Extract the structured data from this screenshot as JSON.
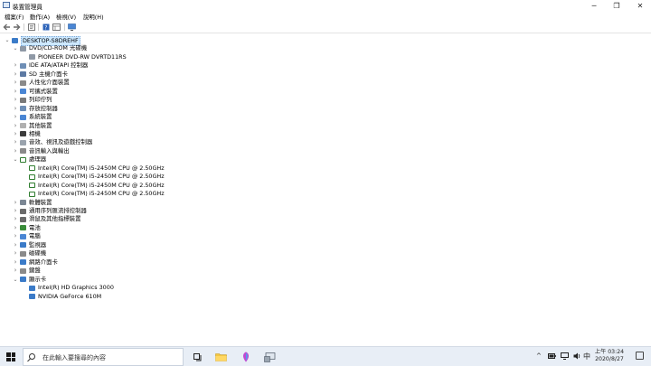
{
  "window": {
    "title": "裝置管理員",
    "minimize_glyph": "─",
    "maximize_glyph": "❐",
    "close_glyph": "✕"
  },
  "menu": [
    "檔案(F)",
    "動作(A)",
    "檢視(V)",
    "說明(H)"
  ],
  "toolbar": {
    "icons": [
      "back-arrow-icon",
      "forward-arrow-icon",
      "properties-icon",
      "help-icon",
      "view-icon",
      "monitor-scan-icon"
    ]
  },
  "tree": {
    "root": "DESKTOP-S8DREHF",
    "nodes": [
      {
        "label": "DVD/CD-ROM 光碟機",
        "expanded": true,
        "icon": "optical-drive-icon",
        "children": [
          "PIONEER DVD-RW DVRTD11RS"
        ]
      },
      {
        "label": "IDE ATA/ATAPI 控制器",
        "expanded": false,
        "icon": "ide-controller-icon"
      },
      {
        "label": "SD 主機介面卡",
        "expanded": false,
        "icon": "sd-host-icon"
      },
      {
        "label": "人性化介面裝置",
        "expanded": false,
        "icon": "hid-icon"
      },
      {
        "label": "可攜式裝置",
        "expanded": false,
        "icon": "portable-device-icon"
      },
      {
        "label": "列印佇列",
        "expanded": false,
        "icon": "printer-icon"
      },
      {
        "label": "存放控制器",
        "expanded": false,
        "icon": "storage-controller-icon"
      },
      {
        "label": "系統裝置",
        "expanded": false,
        "icon": "system-device-icon"
      },
      {
        "label": "其他裝置",
        "expanded": false,
        "icon": "other-device-icon"
      },
      {
        "label": "相機",
        "expanded": false,
        "icon": "camera-icon"
      },
      {
        "label": "音效、視訊及遊戲控制器",
        "expanded": false,
        "icon": "sound-icon"
      },
      {
        "label": "音訊輸入與輸出",
        "expanded": false,
        "icon": "audio-io-icon"
      },
      {
        "label": "處理器",
        "expanded": true,
        "icon": "processor-icon",
        "children": [
          "Intel(R) Core(TM) i5-2450M CPU @ 2.50GHz",
          "Intel(R) Core(TM) i5-2450M CPU @ 2.50GHz",
          "Intel(R) Core(TM) i5-2450M CPU @ 2.50GHz",
          "Intel(R) Core(TM) i5-2450M CPU @ 2.50GHz"
        ]
      },
      {
        "label": "軟體裝置",
        "expanded": false,
        "icon": "software-device-icon"
      },
      {
        "label": "通用序列匯流排控制器",
        "expanded": false,
        "icon": "usb-icon"
      },
      {
        "label": "滑鼠及其他指標裝置",
        "expanded": false,
        "icon": "mouse-icon"
      },
      {
        "label": "電池",
        "expanded": false,
        "icon": "battery-icon"
      },
      {
        "label": "電腦",
        "expanded": false,
        "icon": "computer-icon"
      },
      {
        "label": "監視器",
        "expanded": false,
        "icon": "monitor-icon"
      },
      {
        "label": "磁碟機",
        "expanded": false,
        "icon": "disk-drive-icon"
      },
      {
        "label": "網路介面卡",
        "expanded": false,
        "icon": "network-adapter-icon"
      },
      {
        "label": "鍵盤",
        "expanded": false,
        "icon": "keyboard-icon"
      },
      {
        "label": "顯示卡",
        "expanded": true,
        "icon": "display-adapter-icon",
        "children": [
          "Intel(R) HD Graphics 3000",
          "NVIDIA GeForce 610M"
        ]
      }
    ]
  },
  "taskbar": {
    "search_placeholder": "在此輸入要搜尋的內容",
    "tray_chevron": "^",
    "ime": "中",
    "time": "上午 03:24",
    "date": "2020/8/27"
  },
  "colors": {
    "selection": "#cce8ff",
    "taskbar": "#e8eef6",
    "folder_yellow": "#f2c744",
    "icon_blue": "#3b7bc8"
  }
}
